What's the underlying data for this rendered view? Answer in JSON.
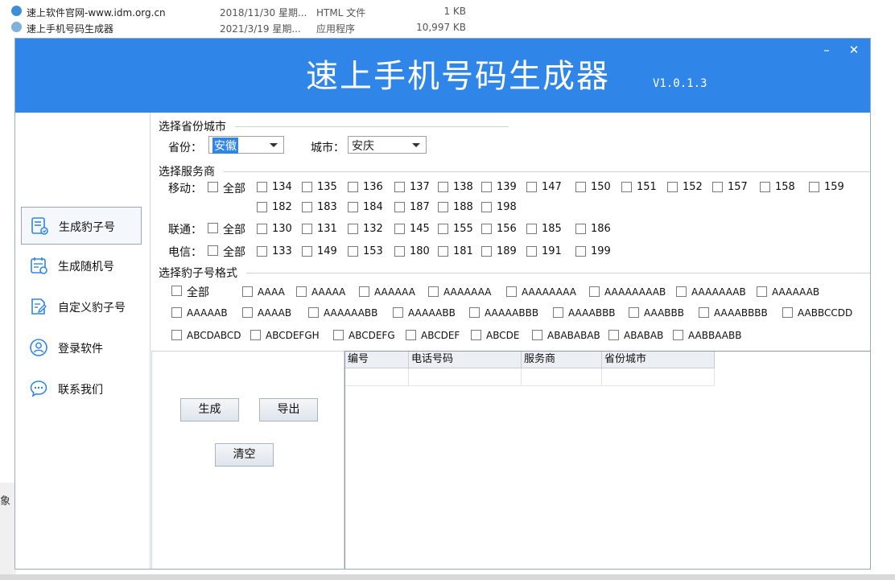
{
  "explorer": {
    "files": [
      {
        "name": "速上软件官网-www.idm.org.cn",
        "date": "2018/11/30 星期...",
        "type": "HTML 文件",
        "size": "1 KB"
      },
      {
        "name": "速上手机号码生成器",
        "date": "2021/3/19 星期...",
        "type": "应用程序",
        "size": "10,997 KB"
      }
    ],
    "side_label": "象"
  },
  "window": {
    "title": "速上手机号码生成器",
    "version": "V1.0.1.3",
    "minimize": "–",
    "close": "✕"
  },
  "sidebar": {
    "items": [
      {
        "label": "生成豹子号",
        "icon": "document-list-icon"
      },
      {
        "label": "生成随机号",
        "icon": "calendar-icon"
      },
      {
        "label": "自定义豹子号",
        "icon": "edit-document-icon"
      },
      {
        "label": "登录软件",
        "icon": "user-icon"
      },
      {
        "label": "联系我们",
        "icon": "chat-bubble-icon"
      }
    ]
  },
  "region": {
    "section_title": "选择省份城市",
    "province_label": "省份：",
    "province_value": "安徽",
    "city_label": "城市：",
    "city_value": "安庆"
  },
  "carrier": {
    "section_title": "选择服务商",
    "all_label": "全部",
    "mobile_label": "移动：",
    "mobile_row1": [
      "134",
      "135",
      "136",
      "137",
      "138",
      "139",
      "147",
      "150",
      "151",
      "152",
      "157",
      "158",
      "159"
    ],
    "mobile_row2": [
      "182",
      "183",
      "184",
      "187",
      "188",
      "198"
    ],
    "unicom_label": "联通：",
    "unicom": [
      "130",
      "131",
      "132",
      "145",
      "155",
      "156",
      "185",
      "186"
    ],
    "telecom_label": "电信：",
    "telecom": [
      "133",
      "149",
      "153",
      "180",
      "181",
      "189",
      "191",
      "199"
    ]
  },
  "format": {
    "section_title": "选择豹子号格式",
    "all_label": "全部",
    "row1": [
      "AAAA",
      "AAAAA",
      "AAAAAA",
      "AAAAAAA",
      "AAAAAAAA",
      "AAAAAAAAB",
      "AAAAAAAB",
      "AAAAAAB"
    ],
    "row2": [
      "AAAAAB",
      "AAAAB",
      "AAAAAABB",
      "AAAAABB",
      "AAAAABBB",
      "AAAABBB",
      "AAABBB",
      "AAAABBBB",
      "AABBCCDD"
    ],
    "row3": [
      "ABCDABCD",
      "ABCDEFGH",
      "ABCDEFG",
      "ABCDEF",
      "ABCDE",
      "ABABABAB",
      "ABABAB",
      "AABBAABB"
    ]
  },
  "actions": {
    "generate": "生成",
    "export": "导出",
    "clear": "清空"
  },
  "table": {
    "columns": [
      "编号",
      "电话号码",
      "服务商",
      "省份城市"
    ],
    "rows": []
  },
  "colors": {
    "accent": "#2f86e8"
  }
}
